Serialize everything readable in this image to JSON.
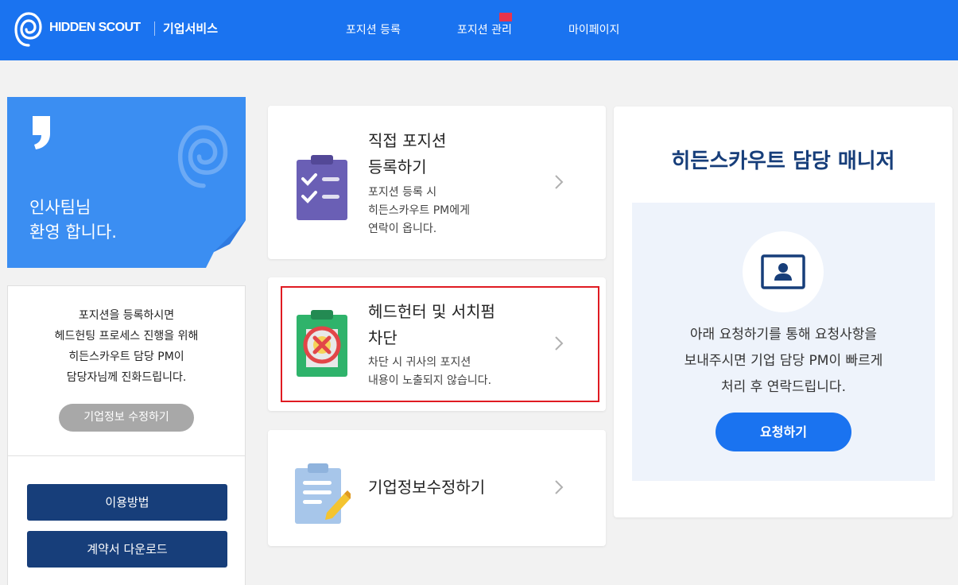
{
  "header": {
    "logo_text": "HIDDEN SCOUT",
    "service_label": "기업서비스",
    "nav": [
      "포지션 등록",
      "포지션 관리",
      "마이페이지"
    ]
  },
  "welcome": {
    "line1": "인사팀님",
    "line2": "환영 합니다."
  },
  "info_card": {
    "text": "포지션을 등록하시면\n헤드헌팅 프로세스 진행을 위해\n히든스카우트 담당 PM이\n담당자님께 진화드립니다.",
    "edit_button": "기업정보 수정하기",
    "guide_button": "이용방법",
    "contract_button": "계약서 다운로드"
  },
  "cards": [
    {
      "title": "직접 포지션\n등록하기",
      "desc": "포지션 등록 시\n히든스카우트 PM에게\n연락이 옵니다.",
      "icon": "clipboard-check-icon"
    },
    {
      "title": "헤드헌터 및 서치펌\n차단",
      "desc": "차단 시 귀사의 포지션\n내용이 노출되지 않습니다.",
      "icon": "clipboard-block-icon"
    },
    {
      "title": "기업정보수정하기",
      "desc": "",
      "icon": "clipboard-edit-icon"
    }
  ],
  "manager": {
    "title": "히든스카우트 담당 매니저",
    "text": "아래 요청하기를 통해 요청사항을\n보내주시면 기업 담당 PM이 빠르게\n처리 후 연락드립니다.",
    "button": "요청하기"
  },
  "colors": {
    "brand_blue": "#1a73f0",
    "welcome_blue": "#3b8ef2",
    "navy": "#173e7a",
    "highlight_red": "#e01b22",
    "flag_red": "#e8344c"
  }
}
